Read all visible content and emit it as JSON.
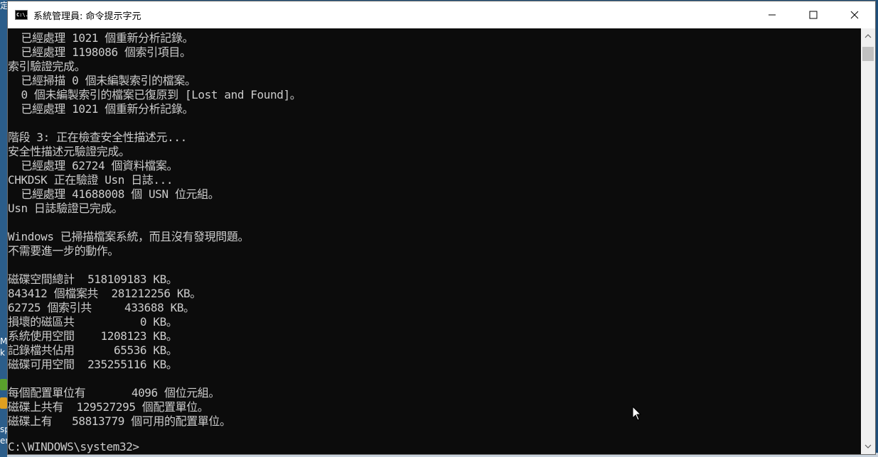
{
  "window": {
    "title": "系統管理員: 命令提示字元",
    "icon_label": "C:\\."
  },
  "desktop": {
    "glyphs": [
      "定",
      "M",
      "k",
      "sp",
      "en"
    ]
  },
  "console": {
    "lines": [
      "  已經處理 1021 個重新分析記錄。",
      "  已經處理 1198086 個索引項目。",
      "索引驗證完成。",
      "  已經掃描 0 個未編製索引的檔案。",
      "  0 個未編製索引的檔案已復原到 [Lost and Found]。",
      "  已經處理 1021 個重新分析記錄。",
      "",
      "階段 3: 正在檢查安全性描述元...",
      "安全性描述元驗證完成。",
      "  已經處理 62724 個資料檔案。",
      "CHKDSK 正在驗證 Usn 日誌...",
      "  已經處理 41688008 個 USN 位元組。",
      "Usn 日誌驗證已完成。",
      "",
      "Windows 已掃描檔案系統，而且沒有發現問題。",
      "不需要進一步的動作。",
      "",
      "磁碟空間總計  518109183 KB。",
      "843412 個檔案共  281212256 KB。",
      "62725 個索引共     433688 KB。",
      "損壞的磁區共          0 KB。",
      "系統使用空間    1208123 KB。",
      "記錄檔共佔用      65536 KB。",
      "磁碟可用空間  235255116 KB。",
      "",
      "每個配置單位有       4096 個位元組。",
      "磁碟上共有  129527295 個配置單位。",
      "磁碟上有   58813779 個可用的配置單位。",
      "",
      "C:\\WINDOWS\\system32>"
    ]
  },
  "colors": {
    "console_bg": "#0c0c0c",
    "console_fg": "#cccccc",
    "titlebar_bg": "#ffffff"
  }
}
